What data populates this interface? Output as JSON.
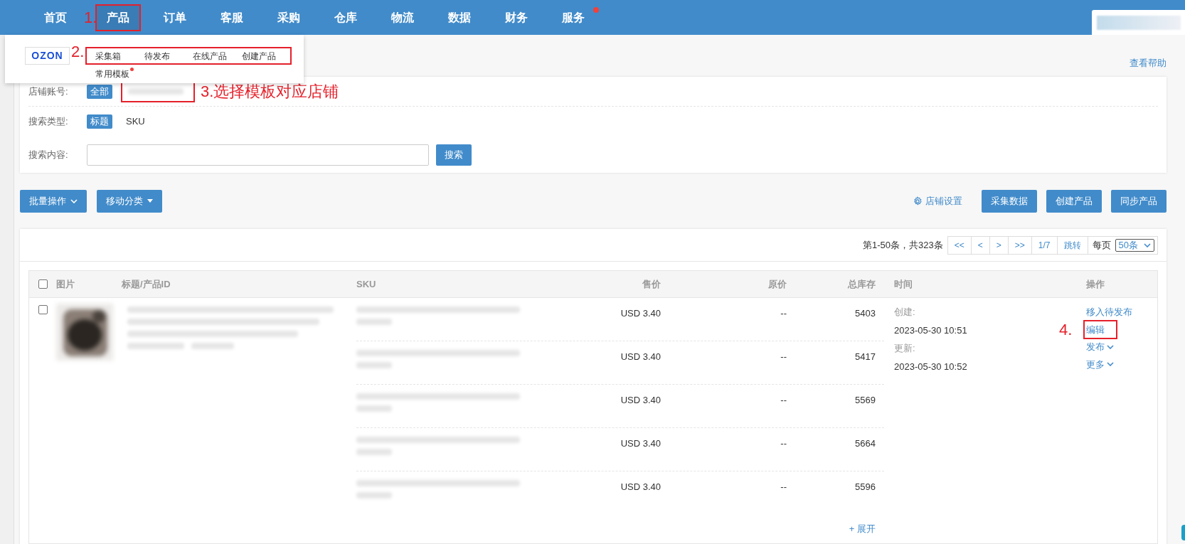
{
  "nav": {
    "items": [
      {
        "label": "首页",
        "selected": false
      },
      {
        "label": "产品",
        "selected": true,
        "callout": "1."
      },
      {
        "label": "订单",
        "selected": false
      },
      {
        "label": "客服",
        "selected": false
      },
      {
        "label": "采购",
        "selected": false
      },
      {
        "label": "仓库",
        "selected": false
      },
      {
        "label": "物流",
        "selected": false
      },
      {
        "label": "数据",
        "selected": false
      },
      {
        "label": "财务",
        "selected": false
      },
      {
        "label": "服务",
        "selected": false,
        "badge": true
      }
    ]
  },
  "dropdown": {
    "logo": "OZON",
    "callout": "2.",
    "items": [
      {
        "label": "采集箱"
      },
      {
        "label": "待发布"
      },
      {
        "label": "在线产品"
      },
      {
        "label": "创建产品"
      }
    ],
    "extra": {
      "label": "常用模板",
      "badge": true
    }
  },
  "help_link": "查看帮助",
  "filters": {
    "shop": {
      "label": "店铺账号:",
      "options": [
        {
          "label": "全部",
          "selected": true
        }
      ],
      "callout": "3.选择模板对应店铺"
    },
    "search_type": {
      "label": "搜索类型:",
      "options": [
        {
          "label": "标题",
          "selected": true
        },
        {
          "label": "SKU",
          "selected": false
        }
      ]
    },
    "search": {
      "label": "搜索内容:",
      "button": "搜索"
    }
  },
  "toolbar": {
    "left": [
      {
        "label": "批量操作",
        "kind": "chevron"
      },
      {
        "label": "移动分类",
        "kind": "triangle"
      }
    ],
    "settings_link": "店铺设置",
    "right": [
      "采集数据",
      "创建产品",
      "同步产品"
    ]
  },
  "pagination": {
    "summary": "第1-50条，共323条",
    "buttons": [
      "<<",
      "<",
      ">",
      ">>",
      "1/7",
      "跳转"
    ],
    "per_page_label": "每页",
    "per_page": "50条"
  },
  "table": {
    "select_all_checked": false,
    "columns": [
      "图片",
      "标题/产品ID",
      "SKU",
      "售价",
      "原价",
      "总库存",
      "时间",
      "操作"
    ],
    "rows": [
      {
        "checked": false,
        "variants": [
          {
            "price": "USD 3.40",
            "original": "--",
            "stock": "5403"
          },
          {
            "price": "USD 3.40",
            "original": "--",
            "stock": "5417"
          },
          {
            "price": "USD 3.40",
            "original": "--",
            "stock": "5569"
          },
          {
            "price": "USD 3.40",
            "original": "--",
            "stock": "5664"
          },
          {
            "price": "USD 3.40",
            "original": "--",
            "stock": "5596"
          }
        ],
        "created_label": "创建:",
        "created": "2023-05-30 10:51",
        "updated_label": "更新:",
        "updated": "2023-05-30 10:52",
        "actions": [
          {
            "label": "移入待发布"
          },
          {
            "label": "编辑",
            "callout": "4."
          },
          {
            "label": "发布",
            "caret": true
          },
          {
            "label": "更多",
            "caret": true
          }
        ],
        "expand": "+ 展开"
      }
    ]
  }
}
